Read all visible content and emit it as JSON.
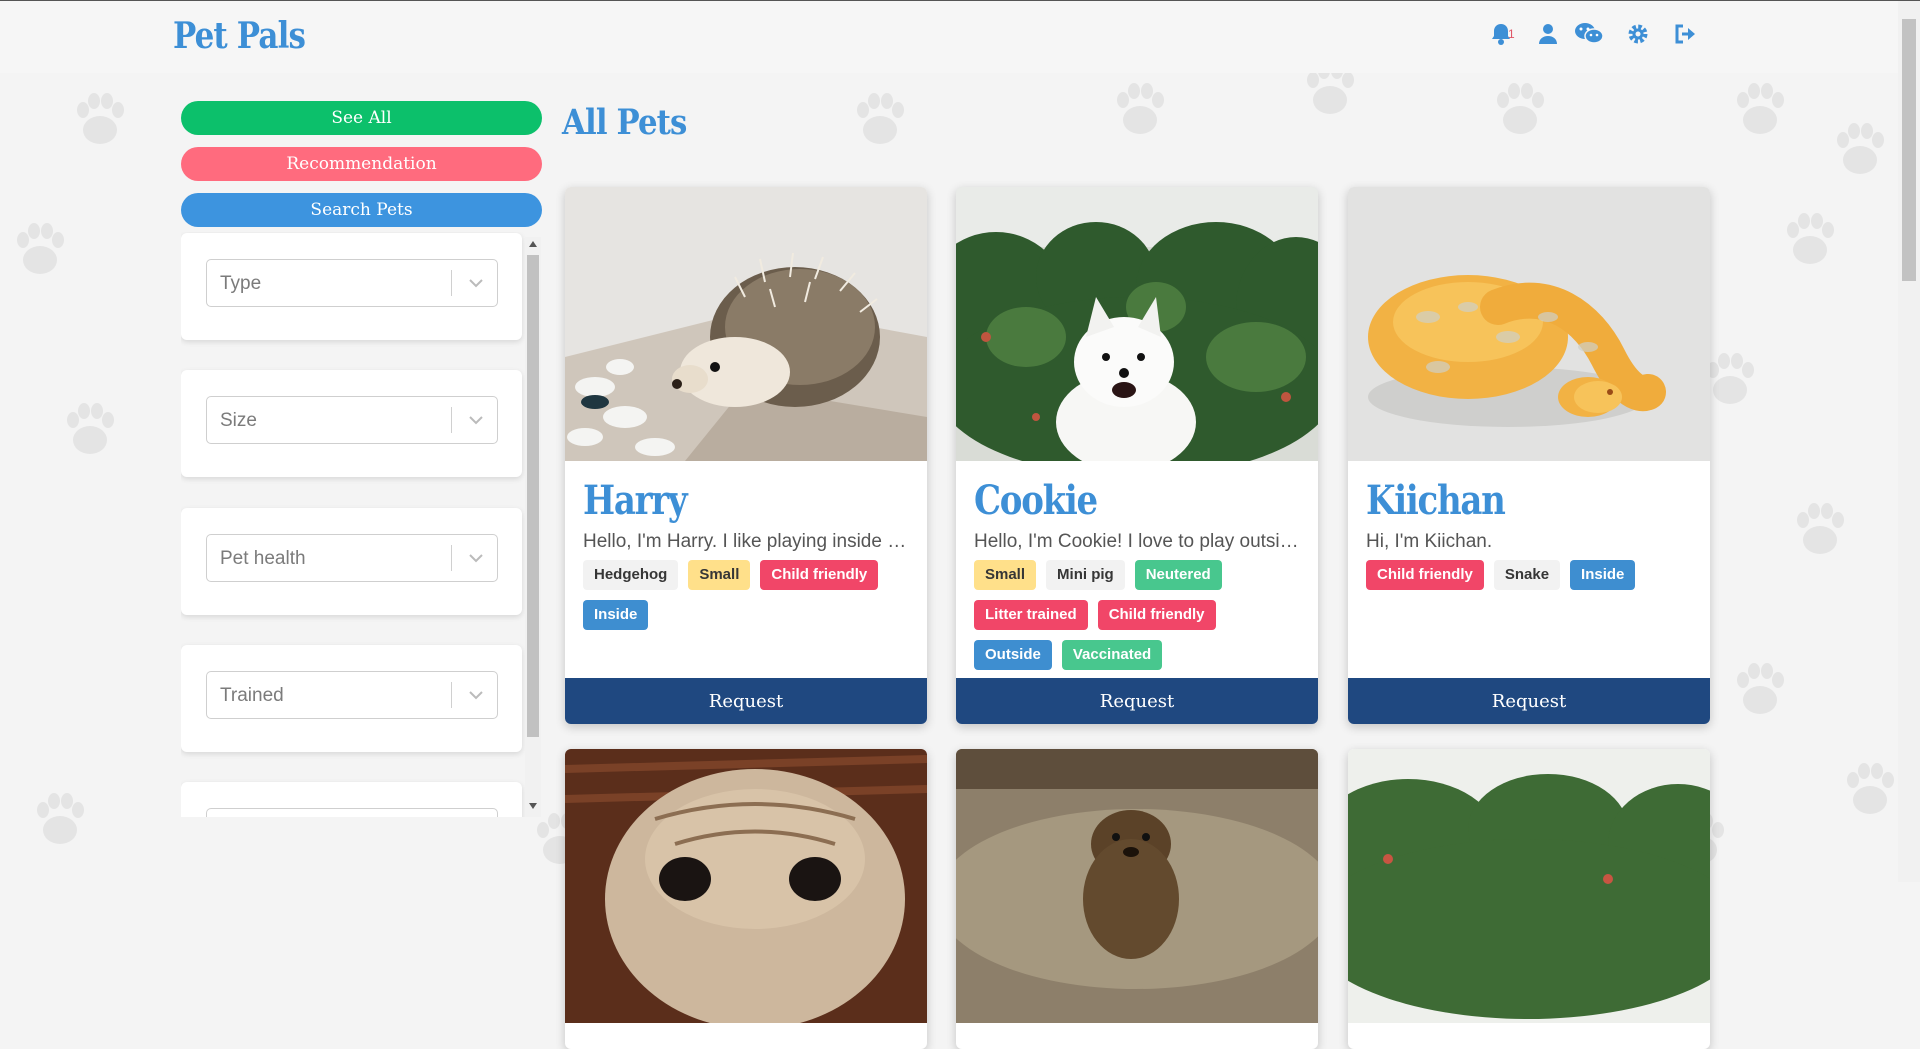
{
  "app": {
    "title": "Pet Pals"
  },
  "header": {
    "notification_count": "1",
    "icons": [
      "bell-icon",
      "user-icon",
      "wechat-icon",
      "gear-icon",
      "logout-icon"
    ]
  },
  "sidebar": {
    "buttons": [
      {
        "label": "See All",
        "color": "#0cc06b"
      },
      {
        "label": "Recommendation",
        "color": "#ff6b7e"
      },
      {
        "label": "Search Pets",
        "color": "#3d94df"
      }
    ],
    "filters": [
      {
        "placeholder": "Type"
      },
      {
        "placeholder": "Size"
      },
      {
        "placeholder": "Pet health"
      },
      {
        "placeholder": "Trained"
      }
    ]
  },
  "main": {
    "title": "All Pets",
    "request_label": "Request",
    "pets": [
      {
        "name": "Harry",
        "description": "Hello, I'm Harry. I like playing inside …",
        "photo": "hedgehog",
        "tags": [
          {
            "label": "Hedgehog",
            "style": "grey"
          },
          {
            "label": "Small",
            "style": "yellow"
          },
          {
            "label": "Child friendly",
            "style": "red"
          },
          {
            "label": "Inside",
            "style": "blue"
          }
        ]
      },
      {
        "name": "Cookie",
        "description": "Hello, I'm Cookie! I love to play outsi…",
        "photo": "white-dog",
        "tags": [
          {
            "label": "Small",
            "style": "yellow"
          },
          {
            "label": "Mini pig",
            "style": "grey"
          },
          {
            "label": "Neutered",
            "style": "green"
          },
          {
            "label": "Litter trained",
            "style": "red"
          },
          {
            "label": "Child friendly",
            "style": "red"
          },
          {
            "label": "Outside",
            "style": "blue"
          },
          {
            "label": "Vaccinated",
            "style": "green"
          }
        ]
      },
      {
        "name": "Kiichan",
        "description": "Hi, I'm Kiichan.",
        "photo": "snake",
        "tags": [
          {
            "label": "Child friendly",
            "style": "red"
          },
          {
            "label": "Snake",
            "style": "grey"
          },
          {
            "label": "Inside",
            "style": "blue"
          }
        ]
      }
    ],
    "more_pets": [
      {
        "photo": "pug"
      },
      {
        "photo": "otter"
      },
      {
        "photo": "garden"
      }
    ]
  },
  "colors": {
    "brand_blue": "#3d8fd6",
    "request_navy": "#1f4880",
    "tag_grey": "#f2f2f2",
    "tag_yellow": "#ffe08a",
    "tag_red": "#f14668",
    "tag_blue": "#3e8ed0",
    "tag_green": "#48c78e"
  }
}
